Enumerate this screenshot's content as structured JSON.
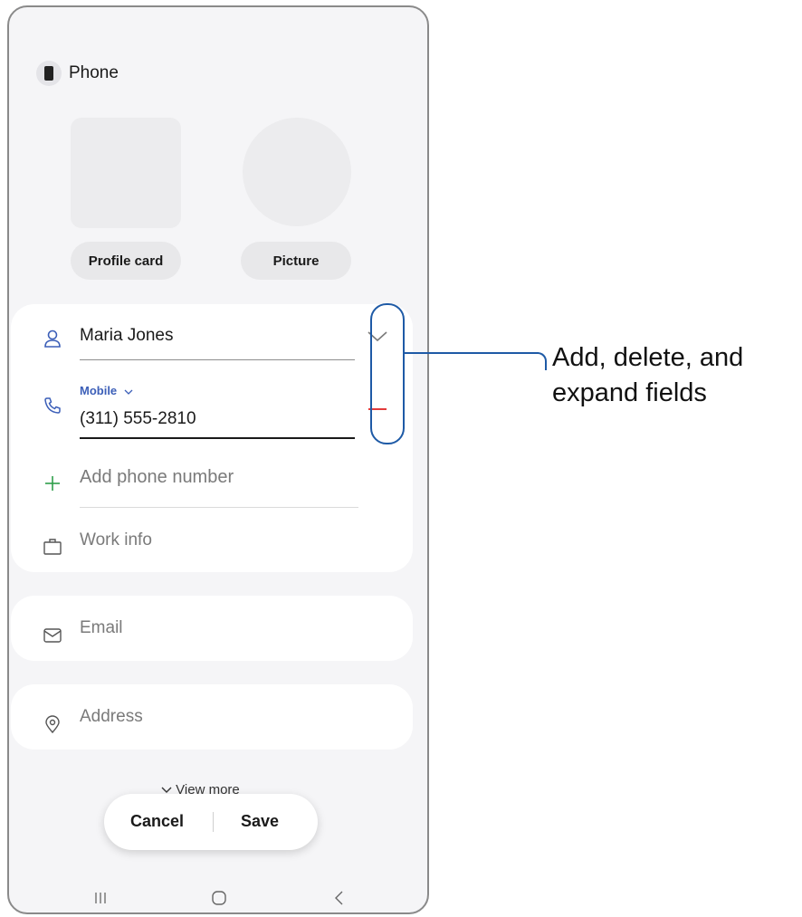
{
  "storage": {
    "label": "Phone",
    "icon": "phone-icon"
  },
  "media": {
    "profile_card_label": "Profile card",
    "picture_label": "Picture"
  },
  "contact": {
    "name": "Maria Jones",
    "phone_type": "Mobile",
    "phone_number": "(311) 555-2810",
    "add_phone_label": "Add phone number",
    "work_info_label": "Work info",
    "email_label": "Email",
    "address_label": "Address"
  },
  "actions": {
    "view_more": "View more",
    "cancel": "Cancel",
    "save": "Save"
  },
  "callout": {
    "line1": "Add, delete, and",
    "line2": "expand fields"
  },
  "colors": {
    "accent": "#1e5aa6",
    "delete": "#e23b3b",
    "add": "#2e9e4a",
    "link": "#3c5fb8"
  }
}
